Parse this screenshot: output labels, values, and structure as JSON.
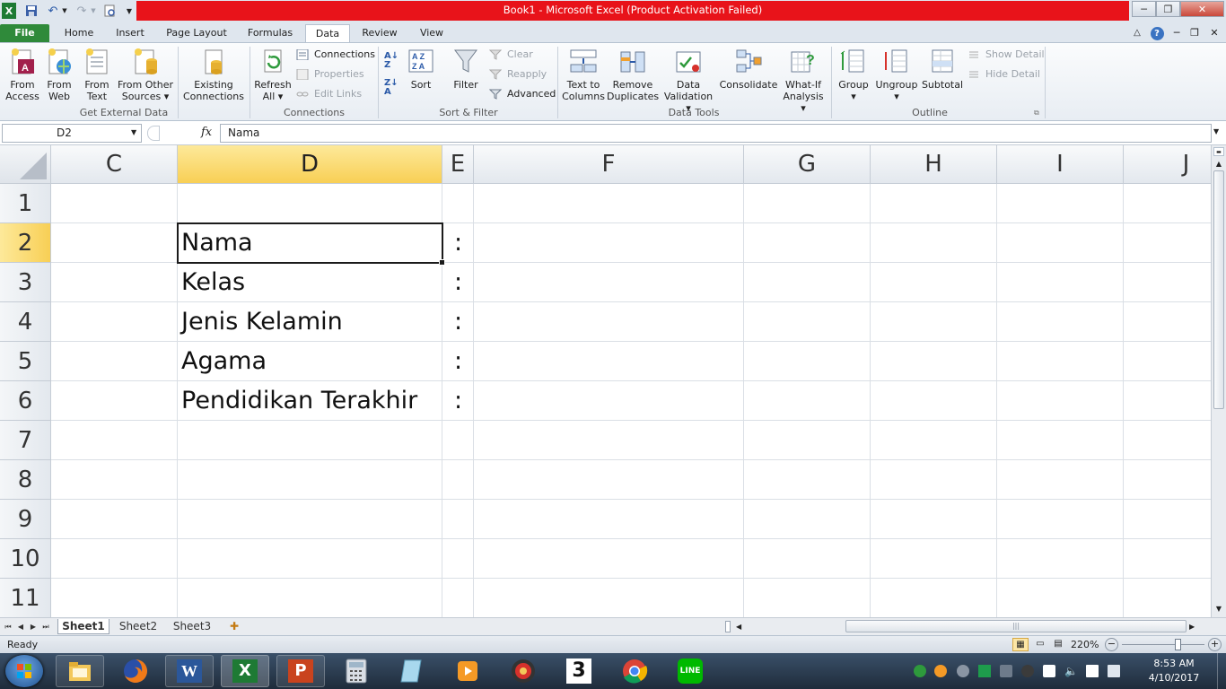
{
  "window": {
    "title": "Book1  -  Microsoft Excel (Product Activation Failed)",
    "title_bar_color": "#e8131a",
    "qat_icons": [
      "excel-logo-icon",
      "save-icon",
      "undo-icon",
      "redo-icon",
      "print-preview-icon",
      "customize-qat-icon"
    ]
  },
  "tabs": [
    {
      "label": "File"
    },
    {
      "label": "Home"
    },
    {
      "label": "Insert"
    },
    {
      "label": "Page Layout"
    },
    {
      "label": "Formulas"
    },
    {
      "label": "Data"
    },
    {
      "label": "Review"
    },
    {
      "label": "View"
    }
  ],
  "active_tab": "Data",
  "ribbon": {
    "get_external_data": {
      "label": "Get External Data",
      "from_access": [
        "From",
        "Access"
      ],
      "from_web": [
        "From",
        "Web"
      ],
      "from_text": [
        "From",
        "Text"
      ],
      "from_other": [
        "From Other",
        "Sources"
      ],
      "existing": [
        "Existing",
        "Connections"
      ]
    },
    "connections": {
      "label": "Connections",
      "refresh": [
        "Refresh",
        "All"
      ],
      "connections": "Connections",
      "properties": "Properties",
      "edit_links": "Edit Links"
    },
    "sort_filter": {
      "label": "Sort & Filter",
      "sort": "Sort",
      "filter": "Filter",
      "clear": "Clear",
      "reapply": "Reapply",
      "advanced": "Advanced"
    },
    "data_tools": {
      "label": "Data Tools",
      "text_to_columns": [
        "Text to",
        "Columns"
      ],
      "remove_duplicates": [
        "Remove",
        "Duplicates"
      ],
      "data_validation": [
        "Data",
        "Validation"
      ],
      "consolidate": "Consolidate",
      "what_if": [
        "What-If",
        "Analysis"
      ]
    },
    "outline": {
      "label": "Outline",
      "group": "Group",
      "ungroup": "Ungroup",
      "subtotal": "Subtotal",
      "show_detail": "Show Detail",
      "hide_detail": "Hide Detail"
    }
  },
  "formula_bar": {
    "name_box": "D2",
    "fx": "fx",
    "value": "Nama"
  },
  "grid": {
    "columns": [
      "C",
      "D",
      "E",
      "F",
      "G",
      "H",
      "I",
      "J"
    ],
    "selected_column": "D",
    "rows": [
      "1",
      "2",
      "3",
      "4",
      "5",
      "6",
      "7",
      "8",
      "9",
      "10",
      "11"
    ],
    "selected_row": "2",
    "cells": {
      "D2": "Nama",
      "E2": ":",
      "D3": "Kelas",
      "E3": ":",
      "D4": "Jenis Kelamin",
      "E4": ":",
      "D5": "Agama",
      "E5": ":",
      "D6": "Pendidikan Terakhir",
      "E6": ":"
    }
  },
  "sheets": [
    "Sheet1",
    "Sheet2",
    "Sheet3"
  ],
  "active_sheet": "Sheet1",
  "status": {
    "mode": "Ready",
    "zoom": "220%"
  },
  "taskbar": {
    "apps": [
      "start-orb-icon",
      "file-explorer-icon",
      "firefox-icon",
      "word-icon",
      "excel-icon",
      "powerpoint-icon",
      "calculator-icon",
      "notepad-icon",
      "media-player-icon",
      "browser-orb-icon",
      "three-app-icon",
      "chrome-icon",
      "line-icon"
    ],
    "time": "8:53 AM",
    "date": "4/10/2017"
  }
}
